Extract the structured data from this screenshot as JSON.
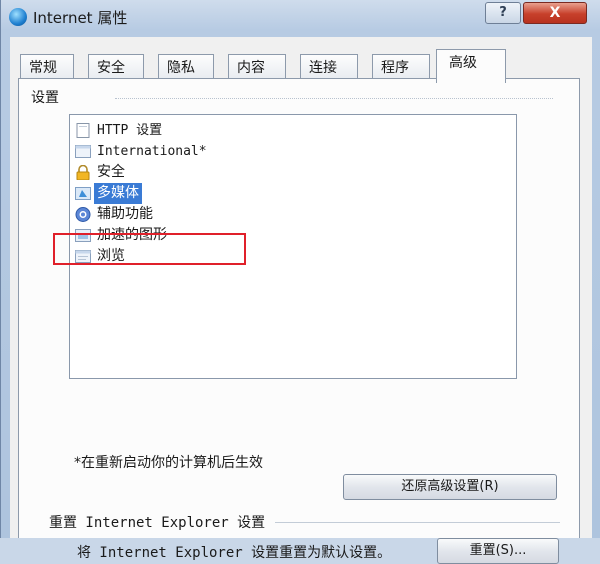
{
  "window": {
    "title": "Internet 属性",
    "help_label": "?",
    "close_label": "X"
  },
  "tabs": [
    {
      "label": "常规"
    },
    {
      "label": "安全"
    },
    {
      "label": "隐私"
    },
    {
      "label": "内容"
    },
    {
      "label": "连接"
    },
    {
      "label": "程序"
    },
    {
      "label": "高级"
    }
  ],
  "active_tab": "高级",
  "settings": {
    "group_label": "设置",
    "items": [
      {
        "label": "HTTP 设置",
        "icon": "page-icon"
      },
      {
        "label": "International*",
        "icon": "page-icon"
      },
      {
        "label": "安全",
        "icon": "lock-icon"
      },
      {
        "label": "多媒体",
        "icon": "media-icon",
        "selected": true
      },
      {
        "label": "辅助功能",
        "icon": "accessibility-icon"
      },
      {
        "label": "加速的图形",
        "icon": "graphics-icon"
      },
      {
        "label": "浏览",
        "icon": "browse-icon"
      }
    ],
    "note": "*在重新启动你的计算机后生效",
    "restore_button": "还原高级设置(R)"
  },
  "reset": {
    "heading": "重置 Internet Explorer 设置",
    "description": "将 Internet Explorer 设置重置为默认设置。",
    "button": "重置(S)..."
  },
  "colors": {
    "selection": "#3a7bd5",
    "highlight_box": "#e0202a"
  }
}
